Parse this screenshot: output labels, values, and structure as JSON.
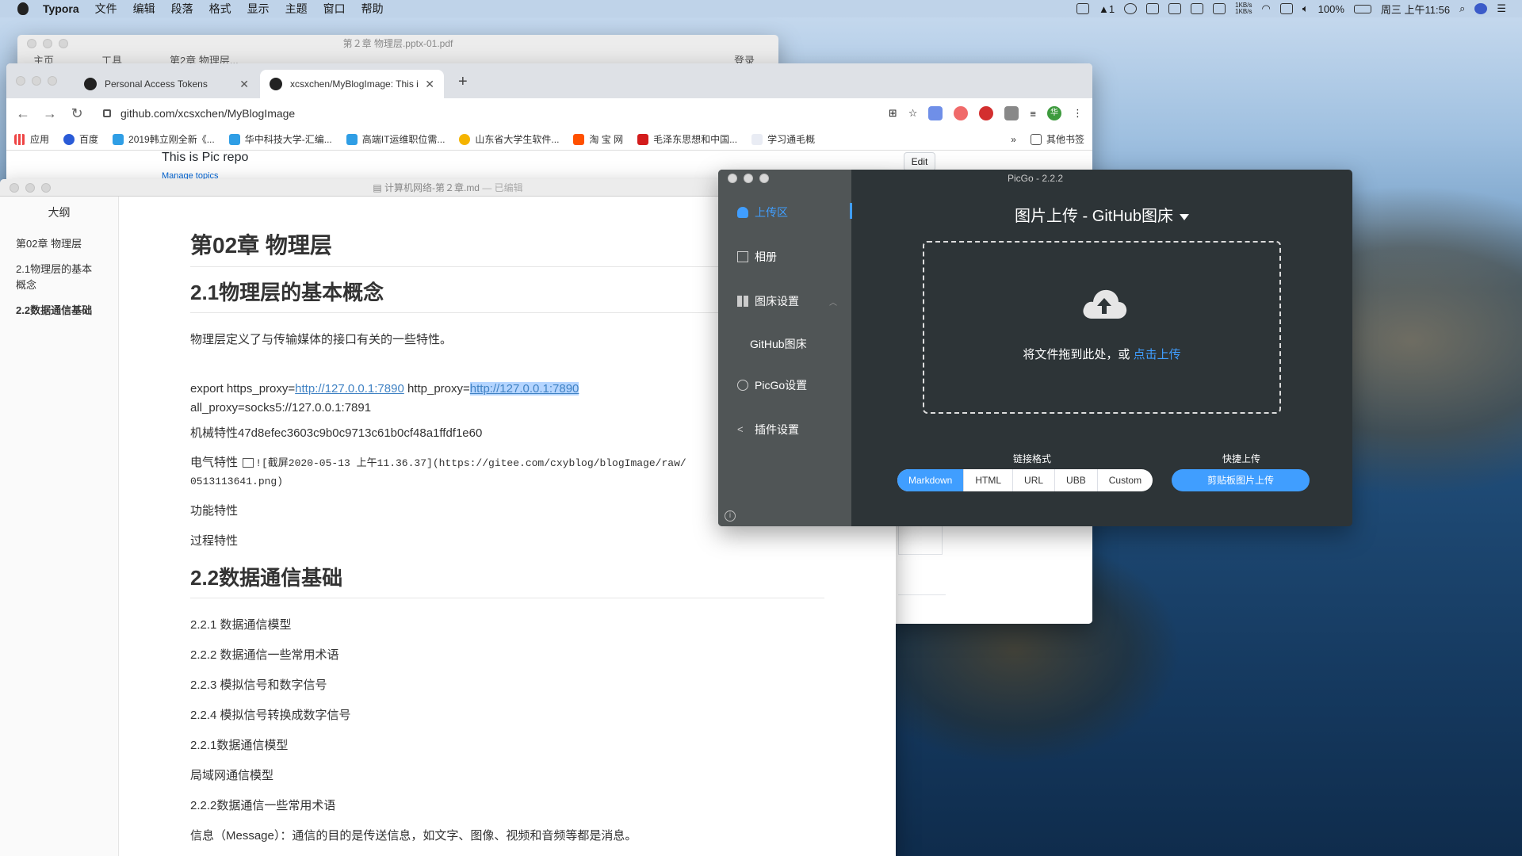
{
  "menubar": {
    "app_name": "Typora",
    "menus": [
      "文件",
      "编辑",
      "段落",
      "格式",
      "显示",
      "主题",
      "窗口",
      "帮助"
    ],
    "notification_count": "1",
    "net_speed_up": "1KB/s",
    "net_speed_down": "1KB/s",
    "battery": "100%",
    "clock": "周三 上午11:56"
  },
  "pdf_window": {
    "title": "第２章 物理层.pptx-01.pdf",
    "tabs": [
      "主页",
      "工具",
      "第2章 物理层..."
    ],
    "sign_in": "登录"
  },
  "chrome": {
    "tabs": [
      {
        "label": "Personal Access Tokens"
      },
      {
        "label": "xcsxchen/MyBlogImage: This i"
      }
    ],
    "url": "github.com/xcsxchen/MyBlogImage",
    "bookmarks": [
      "应用",
      "百度",
      "2019韩立刚全新《...",
      "华中科技大学-汇编...",
      "高端IT运维职位需...",
      "山东省大学生软件...",
      "淘 宝 网",
      "毛泽东思想和中国...",
      "学习通毛概"
    ],
    "more": "»",
    "other_bookmarks": "其他书签",
    "profile_initial": "华",
    "page": {
      "repo_description": "This is Pic repo",
      "manage_topics": "Manage topics",
      "edit_label": "Edit"
    }
  },
  "typora": {
    "title": "计算机网络-第２章.md",
    "title_status": "— 已编辑",
    "outline_title": "大纲",
    "outline": [
      {
        "label": "第02章 物理层"
      },
      {
        "label": "2.1物理层的基本概念"
      },
      {
        "label": "2.2数据通信基础"
      }
    ],
    "h1": "第02章 物理层",
    "h2_1": "2.1物理层的基本概念",
    "p1": "物理层定义了与传输媒体的接口有关的一些特性。",
    "export_prefix": "export https_proxy=",
    "proxy_link_1": "http://127.0.0.1:7890",
    "http_proxy_label": " http_proxy=",
    "proxy_link_2": "http://127.0.0.1:7890",
    "all_proxy": "all_proxy=socks5://127.0.0.1:7891",
    "mech": "机械特性47d8efec3603c9b0c9713c61b0cf48a1ffdf1e60",
    "elec_label": "电气特性",
    "elec_code_1": "![截屏2020-05-13 上午11.36.37](https://gitee.com/cxyblog/blogImage/raw/",
    "elec_code_2": "0513113641.png)",
    "func": "功能特性",
    "proc": "过程特性",
    "h2_2": "2.2数据通信基础",
    "items": [
      "2.2.1 数据通信模型",
      "2.2.2 数据通信一些常用术语",
      "2.2.3 模拟信号和数字信号",
      "2.2.4 模拟信号转换成数字信号",
      "2.2.1数据通信模型",
      "局域网通信模型",
      "2.2.2数据通信一些常用术语",
      "信息（Message）：通信的目的是传送信息，如文字、图像、视频和音频等都是消息。"
    ]
  },
  "picgo": {
    "title": "PicGo - 2.2.2",
    "nav": [
      {
        "label": "上传区"
      },
      {
        "label": "相册"
      },
      {
        "label": "图床设置"
      },
      {
        "label": "GitHub图床"
      },
      {
        "label": "PicGo设置"
      },
      {
        "label": "插件设置"
      }
    ],
    "main_title": "图片上传 - GitHub图床",
    "drop_text": "将文件拖到此处，或 ",
    "drop_link": "点击上传",
    "link_format_label": "链接格式",
    "formats": [
      "Markdown",
      "HTML",
      "URL",
      "UBB",
      "Custom"
    ],
    "quick_upload_label": "快捷上传",
    "clipboard_button": "剪贴板图片上传",
    "accent_color": "#409eff"
  }
}
